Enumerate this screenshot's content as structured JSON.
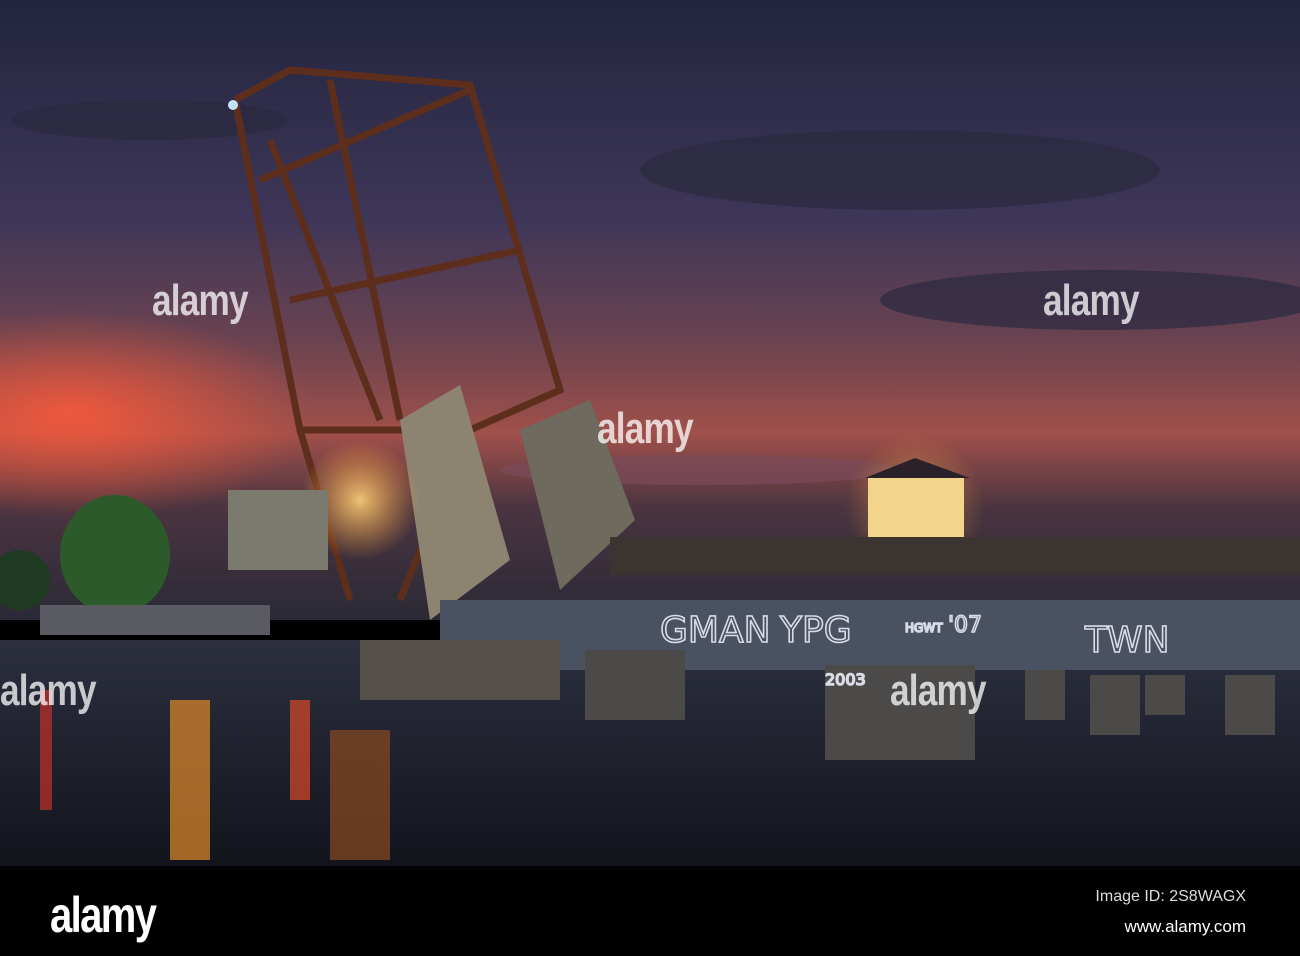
{
  "photo": {
    "subject": "bascule railway bridge at dusk",
    "graffiti": [
      "GMAN",
      "YPG",
      "'07",
      "TWN",
      "2003",
      "HGWT"
    ],
    "colors": {
      "sky_top": "#2a2a4e",
      "sky_glow": "#d9544a",
      "water": "#1d2230",
      "bridge_rust": "#5a2f1e",
      "lamp": "#ffb347"
    }
  },
  "watermark": {
    "text": "alamy"
  },
  "footer": {
    "logo": "alamy",
    "image_id": "Image ID: 2S8WAGX",
    "url": "www.alamy.com"
  }
}
